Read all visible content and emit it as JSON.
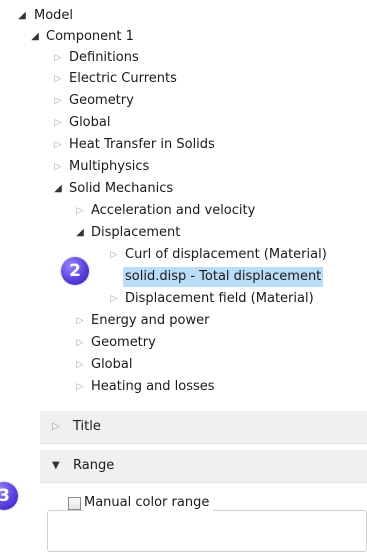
{
  "tree": {
    "model": "Model",
    "component": "Component 1",
    "definitions": "Definitions",
    "electric_currents": "Electric Currents",
    "geometry": "Geometry",
    "global": "Global",
    "heat_transfer": "Heat Transfer in Solids",
    "multiphysics": "Multiphysics",
    "solid_mechanics": "Solid Mechanics",
    "acceleration": "Acceleration and velocity",
    "displacement": "Displacement",
    "curl": "Curl of displacement (Material)",
    "total_disp": "solid.disp - Total displacement",
    "disp_field": "Displacement field (Material)",
    "energy": "Energy and power",
    "sm_geometry": "Geometry",
    "sm_global": "Global",
    "heating": "Heating and losses"
  },
  "sections": {
    "title": "Title",
    "range": "Range"
  },
  "range": {
    "manual_color_range": "Manual color range"
  },
  "badges": {
    "two": "2",
    "three": "3"
  }
}
